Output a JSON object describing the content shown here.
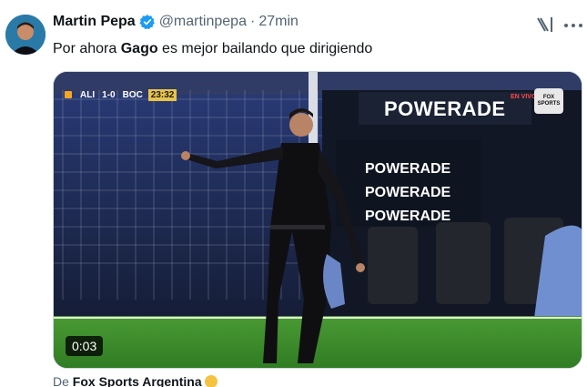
{
  "tweet": {
    "author_name": "Martin Pepa",
    "handle": "@martinpepa",
    "separator": "·",
    "time": "27min",
    "text_parts": [
      "Por ahora ",
      "Gago",
      " es mejor bailando que dirigiendo"
    ]
  },
  "video": {
    "duration": "0:03",
    "scoreboard": {
      "home": "ALI",
      "score": "1-0",
      "away": "BOC",
      "clock": "23:32"
    },
    "live_label": "EN VIVO",
    "broadcaster_logo": "FOX SPORTS",
    "ad_texts": [
      "POWERADE",
      "POWERADE",
      "POWERADE",
      "POWERADE"
    ]
  },
  "attribution": {
    "prefix": "De ",
    "source": "Fox Sports Argentina",
    "emoji_icon": "fist-emoji-icon"
  },
  "colors": {
    "verified": "#1d9bf0",
    "secondary_text": "#536471",
    "primary_text": "#0f1419",
    "pitch": "#3f8f2a",
    "ad_board": "#1a2233"
  }
}
